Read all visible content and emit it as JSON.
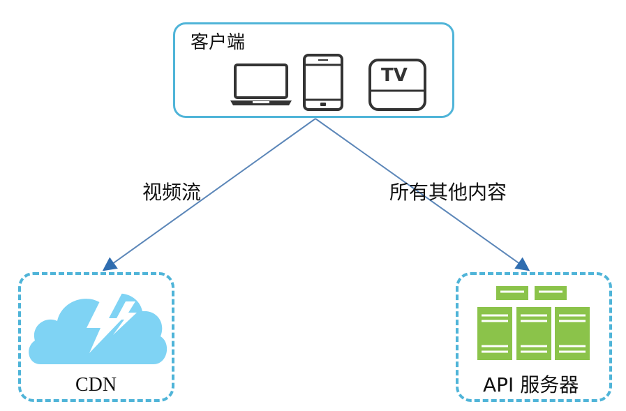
{
  "client": {
    "title": "客户端",
    "devices": [
      {
        "icon": "laptop-icon"
      },
      {
        "icon": "phone-icon"
      },
      {
        "icon": "tv-icon",
        "label": "TV"
      }
    ]
  },
  "edges": {
    "left_label": "视频流",
    "right_label": "所有其他内容"
  },
  "cdn": {
    "label": "CDN",
    "icon": "cloud-lightning-icon"
  },
  "api": {
    "label": "API 服务器",
    "icon": "server-stack-icon"
  },
  "colors": {
    "border": "#4fb4d8",
    "arrow": "#5b86b8",
    "cloud": "#7fd3f4",
    "server": "#8bc34a",
    "device": "#333333"
  }
}
